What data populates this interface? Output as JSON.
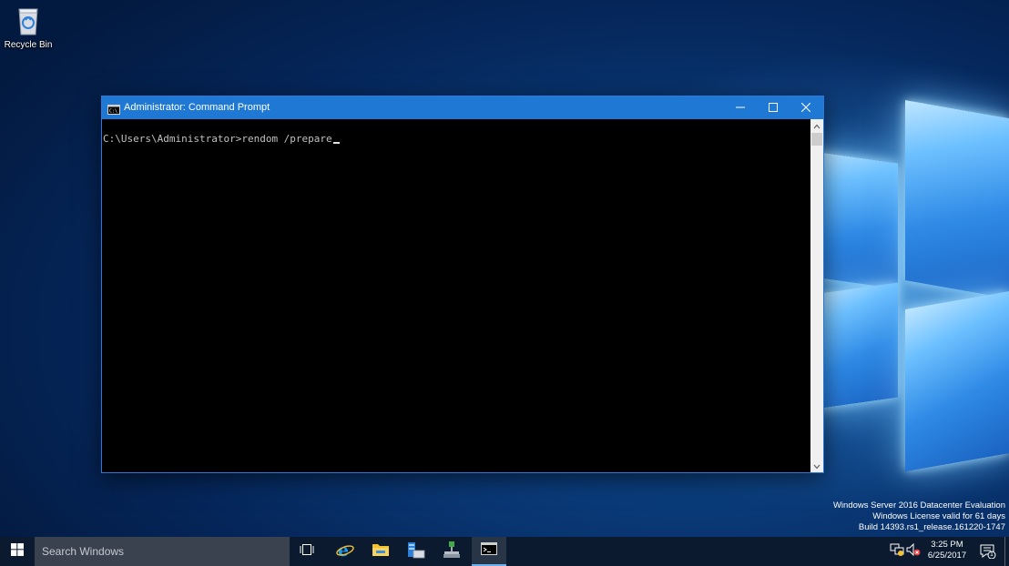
{
  "desktop": {
    "icons": [
      {
        "label": "Recycle Bin",
        "icon": "recycle-bin-icon"
      }
    ],
    "accent_color": "#1e78d4"
  },
  "window": {
    "title": "Administrator: Command Prompt",
    "icon": "command-prompt-icon",
    "controls": {
      "minimize": "minimize-icon",
      "maximize": "maximize-icon",
      "close": "close-icon"
    },
    "console": {
      "prompt": "C:\\Users\\Administrator>",
      "command": "rendom /prepare",
      "background": "#000000",
      "foreground": "#c0c0c0"
    }
  },
  "watermark": {
    "line1": "Windows Server 2016 Datacenter Evaluation",
    "line2": "Windows License valid for 61 days",
    "line3": "Build 14393.rs1_release.161220-1747"
  },
  "taskbar": {
    "search_placeholder": "Search Windows",
    "pinned": [
      {
        "icon": "task-view-icon"
      },
      {
        "icon": "internet-explorer-icon"
      },
      {
        "icon": "file-explorer-icon"
      },
      {
        "icon": "server-manager-icon"
      },
      {
        "icon": "network-admin-icon"
      },
      {
        "icon": "command-prompt-icon",
        "active": true
      }
    ],
    "tray": {
      "icons": [
        "network-icon",
        "volume-muted-icon"
      ],
      "time": "3:25 PM",
      "date": "6/25/2017",
      "notification_icon": "action-center-icon",
      "notification_count": "1"
    }
  }
}
